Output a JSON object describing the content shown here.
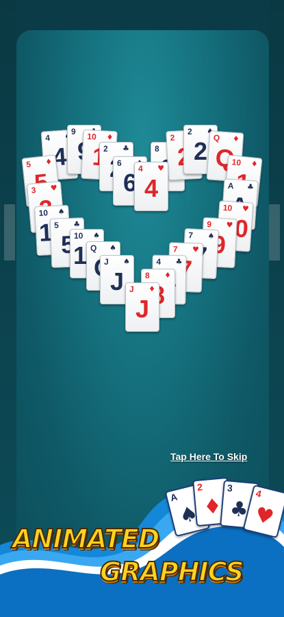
{
  "skip_link": "Tap Here To Skip",
  "banner": {
    "line1": "ANIMATED",
    "line2": "GRAPHICS",
    "cards": [
      {
        "rank": "A",
        "suit": "♠",
        "color": "black"
      },
      {
        "rank": "2",
        "suit": "♦",
        "color": "red"
      },
      {
        "rank": "3",
        "suit": "♣",
        "color": "black"
      },
      {
        "rank": "4",
        "suit": "♥",
        "color": "red"
      }
    ]
  },
  "heart_cards": [
    {
      "rank": "4",
      "suit": "♠",
      "big": "4",
      "color": "black"
    },
    {
      "rank": "9",
      "suit": "♣",
      "big": "9",
      "color": "black"
    },
    {
      "rank": "10",
      "suit": "♦",
      "big": "1",
      "color": "red"
    },
    {
      "rank": "2",
      "suit": "♣",
      "big": "2",
      "color": "black"
    },
    {
      "rank": "8",
      "suit": "♠",
      "big": "8",
      "color": "black"
    },
    {
      "rank": "2",
      "suit": "♦",
      "big": "2",
      "color": "red"
    },
    {
      "rank": "2",
      "suit": "♠",
      "big": "2",
      "color": "black"
    },
    {
      "rank": "Q",
      "suit": "♦",
      "big": "Q",
      "color": "red"
    },
    {
      "rank": "5",
      "suit": "♦",
      "big": "5",
      "color": "red"
    },
    {
      "rank": "6",
      "suit": "♠",
      "big": "6",
      "color": "black"
    },
    {
      "rank": "4",
      "suit": "♥",
      "big": "4",
      "color": "red"
    },
    {
      "rank": "10",
      "suit": "♦",
      "big": "1",
      "color": "red"
    },
    {
      "rank": "A",
      "suit": "♣",
      "big": "A",
      "color": "black"
    },
    {
      "rank": "3",
      "suit": "♥",
      "big": "3",
      "color": "red"
    },
    {
      "rank": "10",
      "suit": "♥",
      "big": "10",
      "color": "red"
    },
    {
      "rank": "10",
      "suit": "♠",
      "big": "10",
      "color": "black"
    },
    {
      "rank": "9",
      "suit": "♥",
      "big": "9",
      "color": "red"
    },
    {
      "rank": "5",
      "suit": "♣",
      "big": "5",
      "color": "black"
    },
    {
      "rank": "7",
      "suit": "♠",
      "big": "7",
      "color": "black"
    },
    {
      "rank": "10",
      "suit": "♠",
      "big": "10",
      "color": "black"
    },
    {
      "rank": "7",
      "suit": "♥",
      "big": "7",
      "color": "red"
    },
    {
      "rank": "Q",
      "suit": "♠",
      "big": "Q",
      "color": "black"
    },
    {
      "rank": "4",
      "suit": "♣",
      "big": "4",
      "color": "black"
    },
    {
      "rank": "J",
      "suit": "♠",
      "big": "J",
      "color": "black"
    },
    {
      "rank": "8",
      "suit": "♦",
      "big": "8",
      "color": "red"
    },
    {
      "rank": "J",
      "suit": "♦",
      "big": "J",
      "color": "red"
    }
  ]
}
